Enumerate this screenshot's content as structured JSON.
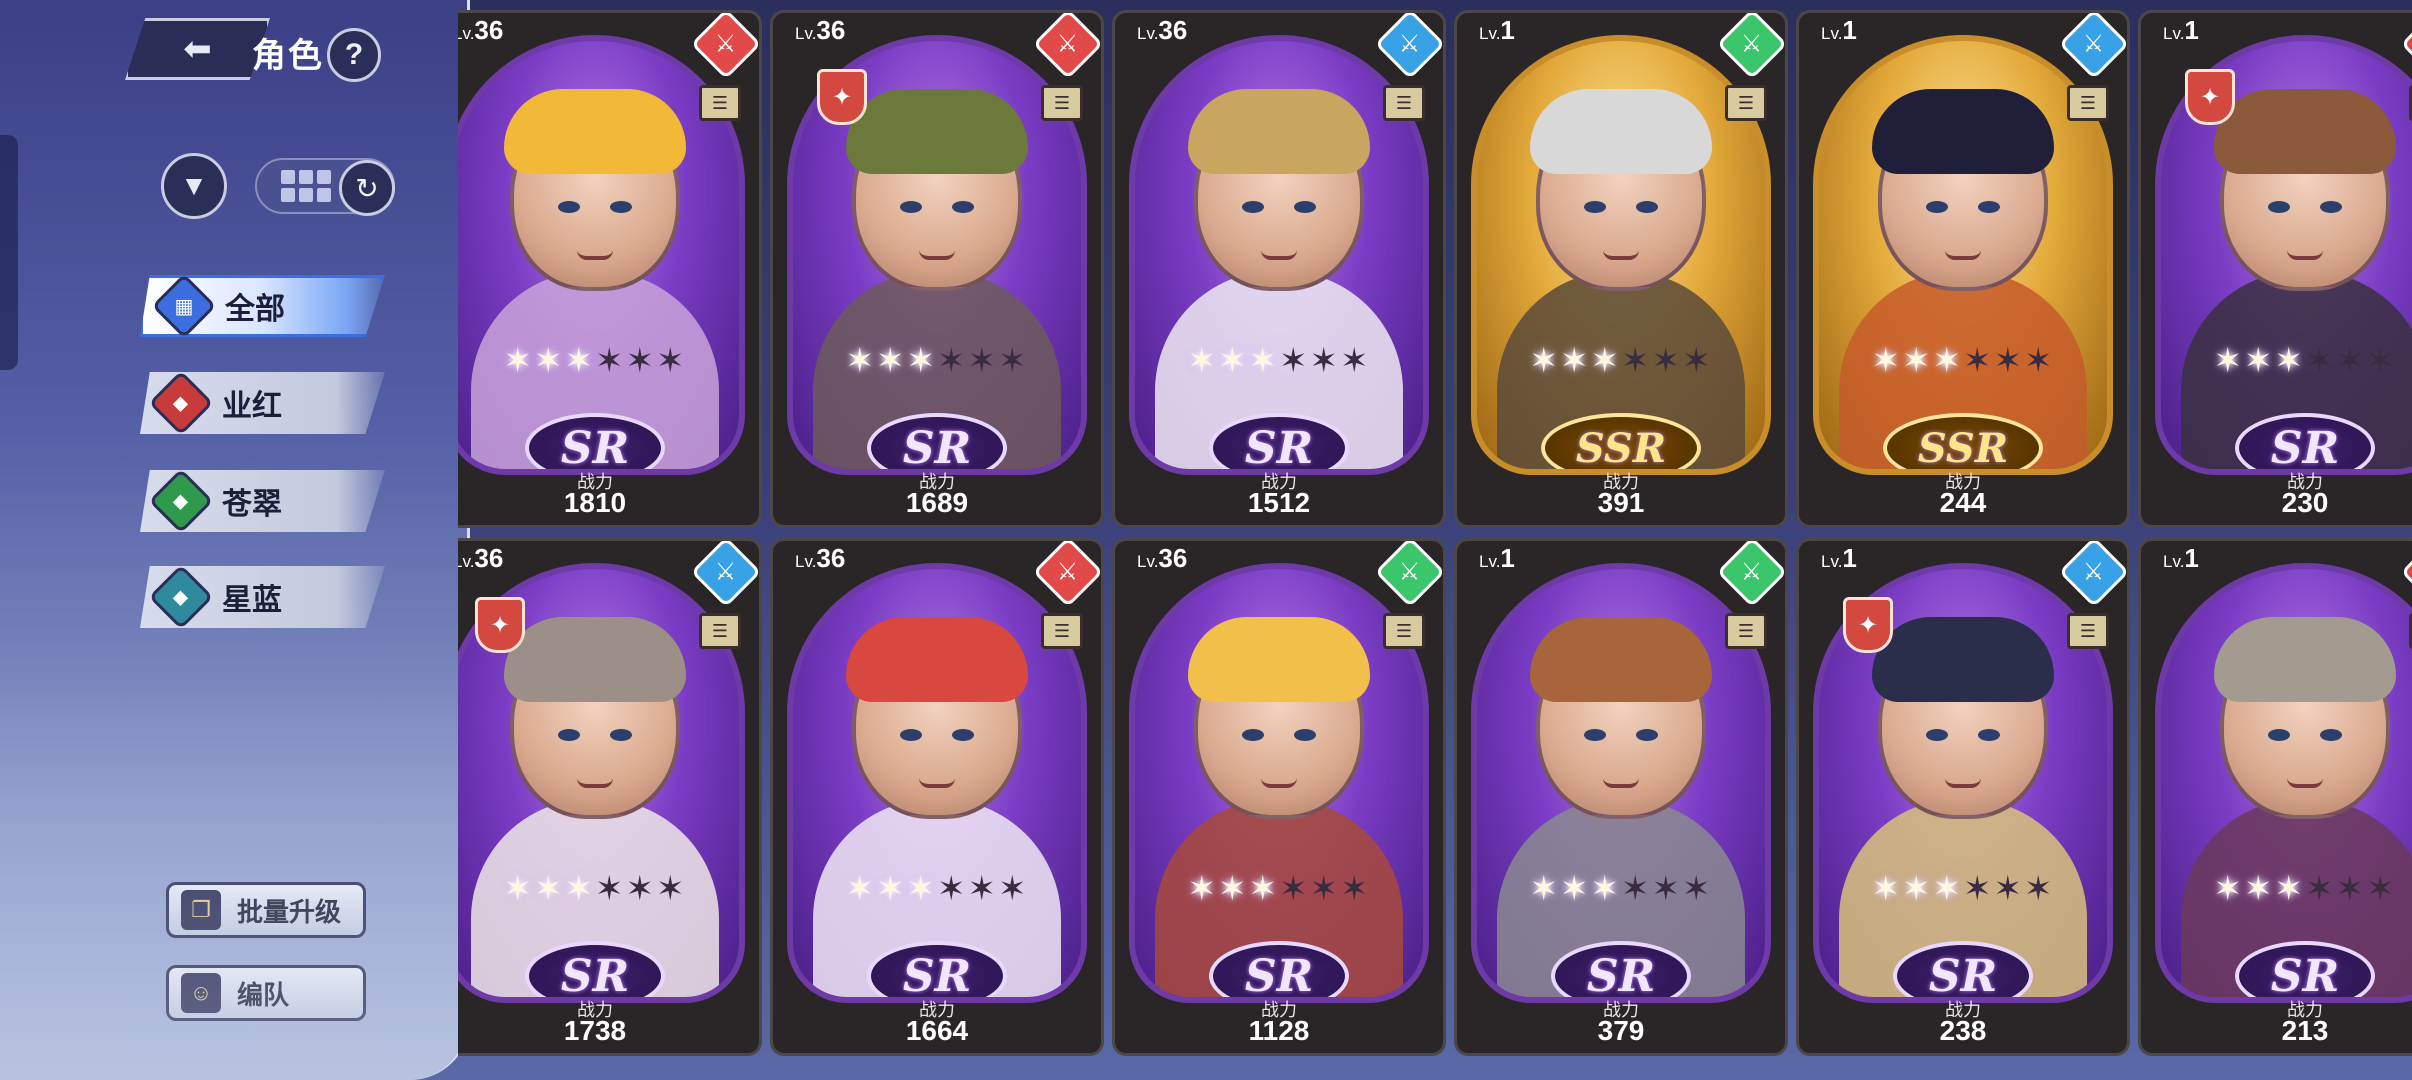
{
  "header": {
    "back_icon": "back-arrow-icon",
    "title": "角色",
    "help_label": "?"
  },
  "toolbar": {
    "filter_icon": "funnel-icon",
    "grid_icon": "grid-view-icon",
    "refresh_icon": "refresh-icon"
  },
  "categories": [
    {
      "label": "全部",
      "icon": "all-icon",
      "color": "#3d6ee0",
      "active": true
    },
    {
      "label": "业红",
      "icon": "red-element-icon",
      "color": "#c83b3b",
      "active": false
    },
    {
      "label": "苍翠",
      "icon": "green-element-icon",
      "color": "#2f9a4c",
      "active": false
    },
    {
      "label": "星蓝",
      "icon": "blue-element-icon",
      "color": "#2f8a9e",
      "active": false
    }
  ],
  "actions": {
    "batch_upgrade": "批量升级",
    "team": "编队"
  },
  "power_label": "战力",
  "cards": [
    {
      "level": "36",
      "lv_prefix": "Lv.",
      "rarity": "SR",
      "element": "red",
      "power": "1810",
      "hair": "#f2b938",
      "body": "#c9a3d9",
      "guild": false,
      "stars": 3
    },
    {
      "level": "36",
      "lv_prefix": "Lv.",
      "rarity": "SR",
      "element": "red",
      "power": "1689",
      "hair": "#6b7a3a",
      "body": "#6d5a5a",
      "guild": true,
      "stars": 3
    },
    {
      "level": "36",
      "lv_prefix": "Lv.",
      "rarity": "SR",
      "element": "blue",
      "power": "1512",
      "hair": "#c9a55f",
      "body": "#eeeaf2",
      "guild": false,
      "stars": 3
    },
    {
      "level": "1",
      "lv_prefix": "Lv.",
      "rarity": "SSR",
      "element": "green",
      "power": "391",
      "hair": "#d8d8d8",
      "body": "#5a4a3a",
      "guild": false,
      "stars": 3
    },
    {
      "level": "1",
      "lv_prefix": "Lv.",
      "rarity": "SSR",
      "element": "blue",
      "power": "244",
      "hair": "#1f1f3a",
      "body": "#c55a2a",
      "guild": false,
      "stars": 3
    },
    {
      "level": "1",
      "lv_prefix": "Lv.",
      "rarity": "SR",
      "element": "red",
      "power": "230",
      "hair": "#8a5a3a",
      "body": "#3a3040",
      "guild": true,
      "stars": 3
    },
    {
      "level": "36",
      "lv_prefix": "Lv.",
      "rarity": "SR",
      "element": "blue",
      "power": "1738",
      "hair": "#9c8f88",
      "body": "#efe8e6",
      "guild": true,
      "stars": 3
    },
    {
      "level": "36",
      "lv_prefix": "Lv.",
      "rarity": "SR",
      "element": "red",
      "power": "1664",
      "hair": "#d8483f",
      "body": "#f0e8f5",
      "guild": false,
      "stars": 3
    },
    {
      "level": "36",
      "lv_prefix": "Lv.",
      "rarity": "SR",
      "element": "green",
      "power": "1128",
      "hair": "#f2c04a",
      "body": "#a84a3a",
      "guild": false,
      "stars": 3
    },
    {
      "level": "1",
      "lv_prefix": "Lv.",
      "rarity": "SR",
      "element": "green",
      "power": "379",
      "hair": "#a8643a",
      "body": "#8a8a8f",
      "guild": false,
      "stars": 3
    },
    {
      "level": "1",
      "lv_prefix": "Lv.",
      "rarity": "SR",
      "element": "blue",
      "power": "238",
      "hair": "#2a2e4a",
      "body": "#d8c27a",
      "guild": true,
      "stars": 3
    },
    {
      "level": "1",
      "lv_prefix": "Lv.",
      "rarity": "SR",
      "element": "red",
      "power": "213",
      "hair": "#a39a90",
      "body": "#6a3a5a",
      "guild": false,
      "stars": 3
    }
  ]
}
